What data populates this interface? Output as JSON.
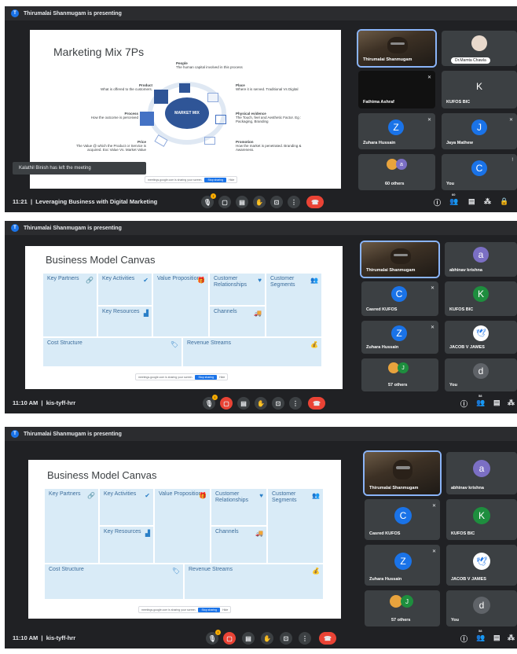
{
  "shot1": {
    "presenting": "Thirumalai Shanmugam is presenting",
    "slide_title": "Marketing Mix 7Ps",
    "center_label": "MARKET MIX",
    "ps": [
      {
        "title": "People",
        "text": "The human capital involved in this process"
      },
      {
        "title": "Product",
        "text": "What is offered to the customers."
      },
      {
        "title": "Place",
        "text": "Where it is served. Traditional Vs Digital"
      },
      {
        "title": "Process",
        "text": "How the outcome is perceived"
      },
      {
        "title": "Physical evidence",
        "text": "The Touch, feel and Aesthetic Factor. Eg : Packaging, Branding"
      },
      {
        "title": "Price",
        "text": "The Value @ which the Product or Service is acquired. Exc Value Vs. Market Value"
      },
      {
        "title": "Promotion",
        "text": "How the market is penetrated. Branding & Awareness."
      }
    ],
    "toast": "Kalathil Binish has left the meeting",
    "time": "11:21",
    "meeting": "Leveraging Business with Digital Marketing",
    "participants": [
      {
        "name": "Thirumalai Shanmugam",
        "type": "video"
      },
      {
        "name": "Dr.Mamta Chawla",
        "type": "photo"
      },
      {
        "name": "Fathima Ashraf",
        "type": "blank"
      },
      {
        "name": "KUFOS BIC",
        "letter": "K",
        "color": "#1e8e3e"
      },
      {
        "name": "Zuhara Hussain",
        "letter": "Z",
        "color": "#1a73e8"
      },
      {
        "name": "Jaya Mathew",
        "letter": "J",
        "color": "#1a73e8"
      },
      {
        "name": "60 others",
        "type": "others"
      },
      {
        "name": "You",
        "letter": "C",
        "color": "#1a73e8"
      }
    ],
    "people_count": "60"
  },
  "shot2": {
    "presenting": "Thirumalai Shanmugam is presenting",
    "slide_title": "Business Model Canvas",
    "time": "11:10 AM",
    "meeting": "kis-tyff-hrr",
    "participants": [
      {
        "name": "Thirumalai Shanmugam",
        "type": "video"
      },
      {
        "name": "abhinav krishna",
        "letter": "a",
        "color": "#7b6fc4"
      },
      {
        "name": "Casred KUFOS",
        "letter": "C",
        "color": "#1a73e8"
      },
      {
        "name": "KUFOS BIC",
        "letter": "K",
        "color": "#1e8e3e"
      },
      {
        "name": "Zuhara Hussain",
        "letter": "Z",
        "color": "#1a73e8"
      },
      {
        "name": "JACOB V JAMES",
        "type": "bird"
      },
      {
        "name": "57 others",
        "type": "others"
      },
      {
        "name": "You",
        "letter": "d",
        "color": "#5f6368"
      }
    ],
    "people_count": "58"
  },
  "shot3": {
    "presenting": "Thirumalai Shanmugam is presenting",
    "slide_title": "Business Model Canvas",
    "time": "11:10 AM",
    "meeting": "kis-tyff-hrr",
    "participants": [
      {
        "name": "Thirumalai Shanmugam",
        "type": "video"
      },
      {
        "name": "abhinav krishna",
        "letter": "a",
        "color": "#7b6fc4"
      },
      {
        "name": "Casred KUFOS",
        "letter": "C",
        "color": "#1a73e8"
      },
      {
        "name": "KUFOS BIC",
        "letter": "K",
        "color": "#1e8e3e"
      },
      {
        "name": "Zuhara Hussain",
        "letter": "Z",
        "color": "#1a73e8"
      },
      {
        "name": "JACOB V JAMES",
        "type": "bird"
      },
      {
        "name": "57 others",
        "type": "others"
      },
      {
        "name": "You",
        "letter": "d",
        "color": "#5f6368"
      }
    ],
    "people_count": "58"
  },
  "bmc": {
    "key_partners": "Key Partners",
    "key_activities": "Key Activities",
    "key_resources": "Key Resources",
    "value_proposition": "Value Proposition",
    "customer_relationships": "Customer Relationships",
    "channels": "Channels",
    "customer_segments": "Customer Segments",
    "cost_structure": "Cost Structure",
    "revenue_streams": "Revenue Streams"
  },
  "share_pill": {
    "text": "meetings.google.com is sharing your screen.",
    "stop": "Stop sharing",
    "hide": "Hide"
  }
}
